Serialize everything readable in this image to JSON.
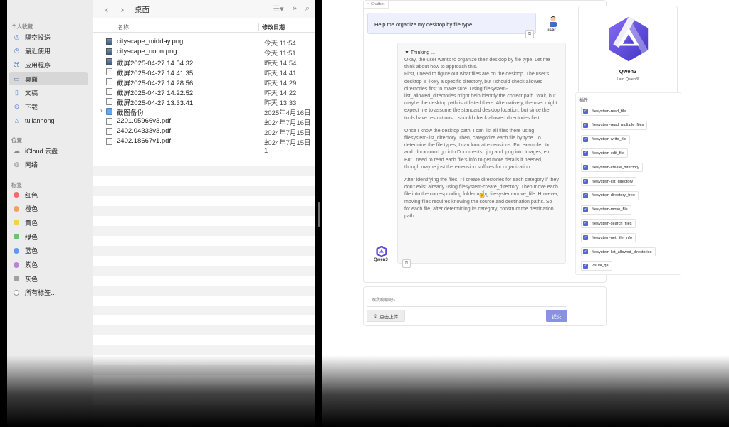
{
  "finder": {
    "title": "桌面",
    "sidebar": {
      "favorites_header": "个人收藏",
      "favorites": [
        {
          "label": "隔空投送",
          "icon": "airdrop-icon"
        },
        {
          "label": "最近使用",
          "icon": "clock-icon"
        },
        {
          "label": "应用程序",
          "icon": "applications-icon"
        },
        {
          "label": "桌面",
          "icon": "desktop-icon",
          "active": true
        },
        {
          "label": "文稿",
          "icon": "document-icon"
        },
        {
          "label": "下载",
          "icon": "download-icon"
        },
        {
          "label": "tujianhong",
          "icon": "home-icon"
        }
      ],
      "locations_header": "位置",
      "locations": [
        {
          "label": "iCloud 云盘",
          "icon": "cloud-icon"
        },
        {
          "label": "网络",
          "icon": "network-icon"
        }
      ],
      "tags_header": "标签",
      "tags": [
        {
          "label": "红色",
          "color": "#f26b6b"
        },
        {
          "label": "橙色",
          "color": "#f5a15a"
        },
        {
          "label": "黄色",
          "color": "#f3d14f"
        },
        {
          "label": "绿色",
          "color": "#6bc46b"
        },
        {
          "label": "蓝色",
          "color": "#5a9cf0"
        },
        {
          "label": "紫色",
          "color": "#b684d8"
        },
        {
          "label": "灰色",
          "color": "#a0a0a0"
        },
        {
          "label": "所有标签…",
          "color": "#ffffff"
        }
      ]
    },
    "columns": {
      "name": "名称",
      "date": "修改日期"
    },
    "files": [
      {
        "name": "cityscape_midday.png",
        "date": "今天 11:54",
        "kind": "img"
      },
      {
        "name": "cityscape_noon.png",
        "date": "今天 11:51",
        "kind": "img"
      },
      {
        "name": "截屏2025-04-27 14.54.32",
        "date": "昨天 14:54",
        "kind": "img"
      },
      {
        "name": "截屏2025-04-27 14.41.35",
        "date": "昨天 14:41",
        "kind": "doc"
      },
      {
        "name": "截屏2025-04-27 14.28.56",
        "date": "昨天 14:29",
        "kind": "doc"
      },
      {
        "name": "截屏2025-04-27 14.22.52",
        "date": "昨天 14:22",
        "kind": "doc"
      },
      {
        "name": "截屏2025-04-27 13.33.41",
        "date": "昨天 13:33",
        "kind": "doc"
      },
      {
        "name": "截图备份",
        "date": "2025年4月16日 1",
        "kind": "folder"
      },
      {
        "name": "2201.05966v3.pdf",
        "date": "2024年7月16日 1",
        "kind": "doc"
      },
      {
        "name": "2402.04333v3.pdf",
        "date": "2024年7月15日 1",
        "kind": "doc"
      },
      {
        "name": "2402.18667v1.pdf",
        "date": "2024年7月15日 1",
        "kind": "doc"
      }
    ]
  },
  "chat": {
    "panel_label": "Chatbot",
    "user_message": "Help me organize my desktop by file type",
    "user_name": "user",
    "thinking_header": "▼ Thinking ...",
    "thinking_paragraphs": [
      "Okay, the user wants to organize their desktop by file type. Let me think about how to approach this.\nFirst, I need to figure out what files are on the desktop. The user's desktop is likely a specific directory, but I should check allowed directories first to make sure. Using filesystem-list_allowed_directories might help identify the correct path. Wait, but maybe the desktop path isn't listed there. Alternatively, the user might expect me to assume the standard desktop location, but since the tools have restrictions, I should check allowed directories first.",
      "Once I know the desktop path, I can list all files there using filesystem-list_directory. Then, categorize each file by type. To determine the file types, I can look at extensions. For example, .txt and .docx could go into Documents, .jpg and .png into Images, etc. But I need to read each file's info to get more details if needed, though maybe just the extension suffices for organization.",
      "After identifying the files, I'll create directories for each category if they don't exist already using filesystem-create_directory. Then move each file into the corresponding folder using filesystem-move_file. However, moving files requires knowing the source and destination paths. So for each file, after determining its category, construct the destination path"
    ],
    "bot_name": "Qwen3",
    "input_placeholder": "跟我聊聊吧~",
    "upload_label": "点击上传",
    "submit_label": "提交"
  },
  "profile": {
    "name": "Qwen3",
    "description": "I am Qwen3!"
  },
  "plugins": {
    "title": "插件",
    "items": [
      "filesystem-read_file",
      "filesystem-read_multiple_files",
      "filesystem-write_file",
      "filesystem-edit_file",
      "filesystem-create_directory",
      "filesystem-list_directory",
      "filesystem-directory_tree",
      "filesystem-move_file",
      "filesystem-search_files",
      "filesystem-get_file_info",
      "filesystem-list_allowed_directories",
      "visual_qa"
    ]
  },
  "colors": {
    "accent": "#5b64d6",
    "submit": "#8891e2",
    "qwen_logo": "#5a4ad6"
  }
}
